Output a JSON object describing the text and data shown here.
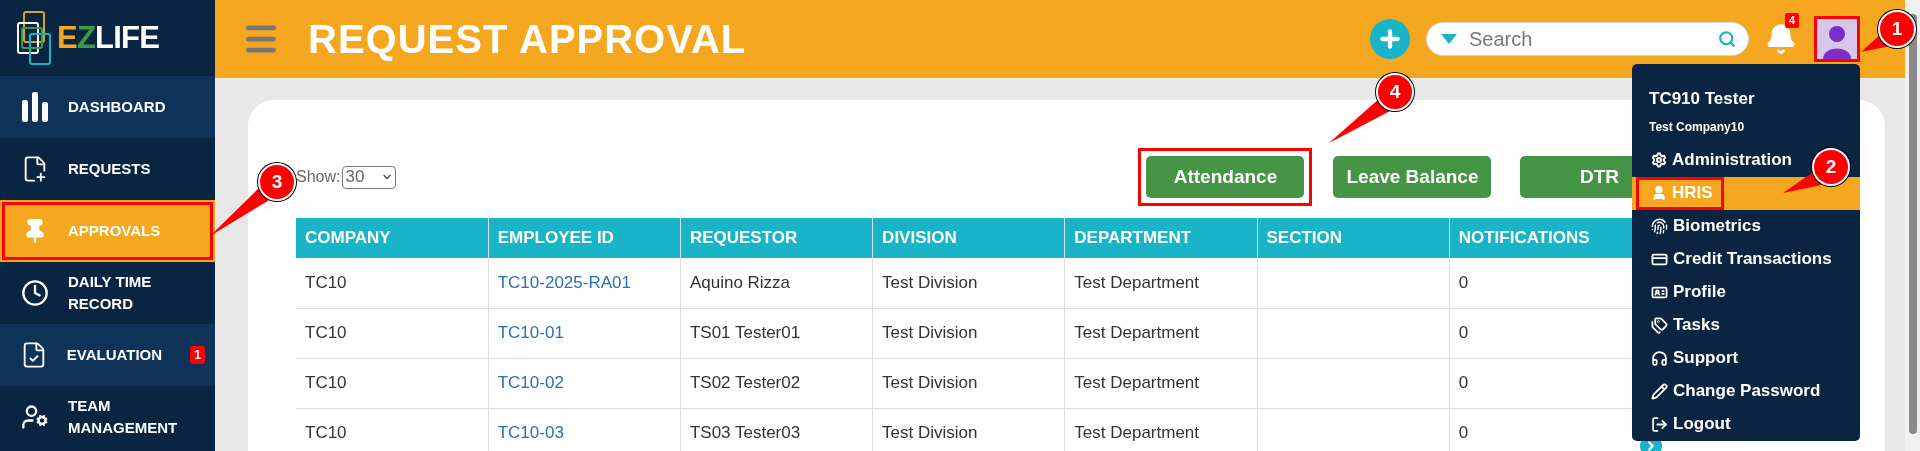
{
  "sidebar": {
    "logo": [
      {
        "text": "E",
        "color": "#f5a81f"
      },
      {
        "text": "Z",
        "color": "#3e9a46"
      },
      {
        "text": "LIFE",
        "color": "#ffffff"
      }
    ],
    "items": [
      {
        "label": "DASHBOARD",
        "selected": false,
        "shaded": true,
        "outlined": false
      },
      {
        "label": "REQUESTS",
        "selected": false,
        "shaded": false,
        "outlined": false
      },
      {
        "label": "APPROVALS",
        "selected": true,
        "outlined": true
      },
      {
        "label": "DAILY TIME RECORD",
        "selected": false,
        "shaded": false,
        "outlined": false
      },
      {
        "label": "EVALUATION",
        "selected": false,
        "shaded": true,
        "outlined": false,
        "badge": "1"
      },
      {
        "label": "TEAM MANAGEMENT",
        "selected": false,
        "shaded": false,
        "outlined": false
      }
    ]
  },
  "header": {
    "title": "REQUEST APPROVAL",
    "search": {
      "placeholder": "Search"
    },
    "notifications_badge": "4",
    "avatar": {
      "outlined": true
    }
  },
  "content": {
    "show_label": "Show:",
    "page_size": "30",
    "buttons": [
      {
        "label": "Attendance",
        "outlined": true
      },
      {
        "label": "Leave Balance",
        "outlined": false
      },
      {
        "label": "DTR",
        "outlined": false
      }
    ],
    "table": {
      "columns": [
        {
          "label": "COMPANY",
          "kind": "text"
        },
        {
          "label": "EMPLOYEE ID",
          "kind": "link"
        },
        {
          "label": "REQUESTOR",
          "kind": "text"
        },
        {
          "label": "DIVISION",
          "kind": "text"
        },
        {
          "label": "DEPARTMENT",
          "kind": "text"
        },
        {
          "label": "SECTION",
          "kind": "text"
        },
        {
          "label": "NOTIFICATIONS",
          "kind": "text"
        }
      ],
      "rows": [
        [
          "TC10",
          "TC10-2025-RA01",
          "Aquino Rizza",
          "Test Division",
          "Test Department",
          "",
          "0"
        ],
        [
          "TC10",
          "TC10-01",
          "TS01 Tester01",
          "Test Division",
          "Test Department",
          "",
          "0"
        ],
        [
          "TC10",
          "TC10-02",
          "TS02 Tester02",
          "Test Division",
          "Test Department",
          "",
          "0"
        ],
        [
          "TC10",
          "TC10-03",
          "TS03 Tester03",
          "Test Division",
          "Test Department",
          "",
          "0"
        ]
      ]
    }
  },
  "user_menu": {
    "name": "TC910 Tester",
    "company": "Test Company10",
    "items": [
      {
        "label": "Administration",
        "selected": false,
        "outlined": false
      },
      {
        "label": "HRIS",
        "selected": true,
        "outlined": true
      },
      {
        "label": "Biometrics",
        "selected": false,
        "outlined": false
      },
      {
        "label": "Credit Transactions",
        "selected": false,
        "outlined": false
      },
      {
        "label": "Profile",
        "selected": false,
        "outlined": false
      },
      {
        "label": "Tasks",
        "selected": false,
        "outlined": false
      },
      {
        "label": "Support",
        "selected": false,
        "outlined": false
      },
      {
        "label": "Change Password",
        "selected": false,
        "outlined": false
      },
      {
        "label": "Logout",
        "selected": false,
        "outlined": false
      }
    ]
  },
  "annotations": [
    {
      "number": "1"
    },
    {
      "number": "2"
    },
    {
      "number": "3"
    },
    {
      "number": "4"
    }
  ]
}
